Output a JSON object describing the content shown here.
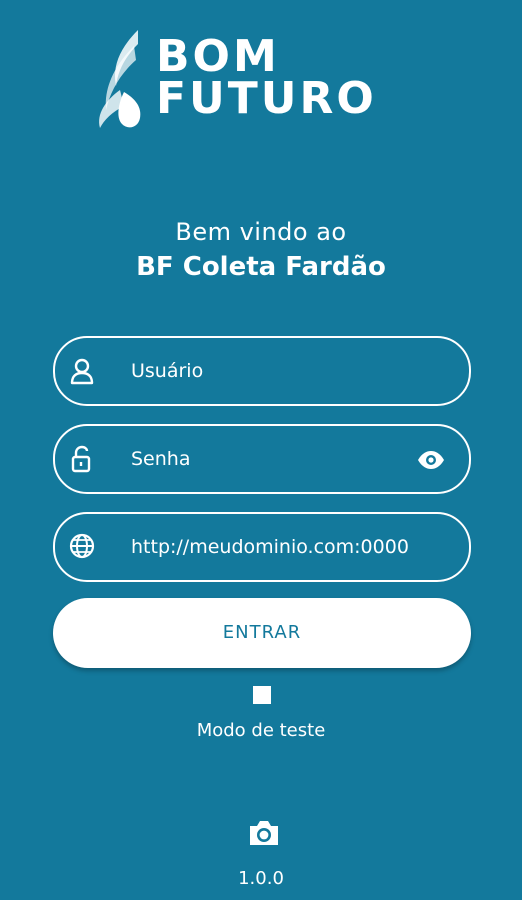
{
  "logo": {
    "line1": "BOM",
    "line2": "FUTURO"
  },
  "welcome": {
    "greeting": "Bem vindo ao",
    "app_name": "BF Coleta Fardão"
  },
  "form": {
    "username_placeholder": "Usuário",
    "password_placeholder": "Senha",
    "server_url": "http://meudominio.com:0000"
  },
  "submit": {
    "label": "ENTRAR"
  },
  "test_mode": {
    "label": "Modo de teste",
    "checked": false
  },
  "footer": {
    "version": "1.0.0"
  },
  "icons": {
    "user": "user-icon",
    "lock": "lock-icon",
    "eye": "eye-icon",
    "globe": "globe-icon",
    "camera": "camera-icon"
  },
  "colors": {
    "background": "#13799c",
    "foreground": "#ffffff"
  }
}
